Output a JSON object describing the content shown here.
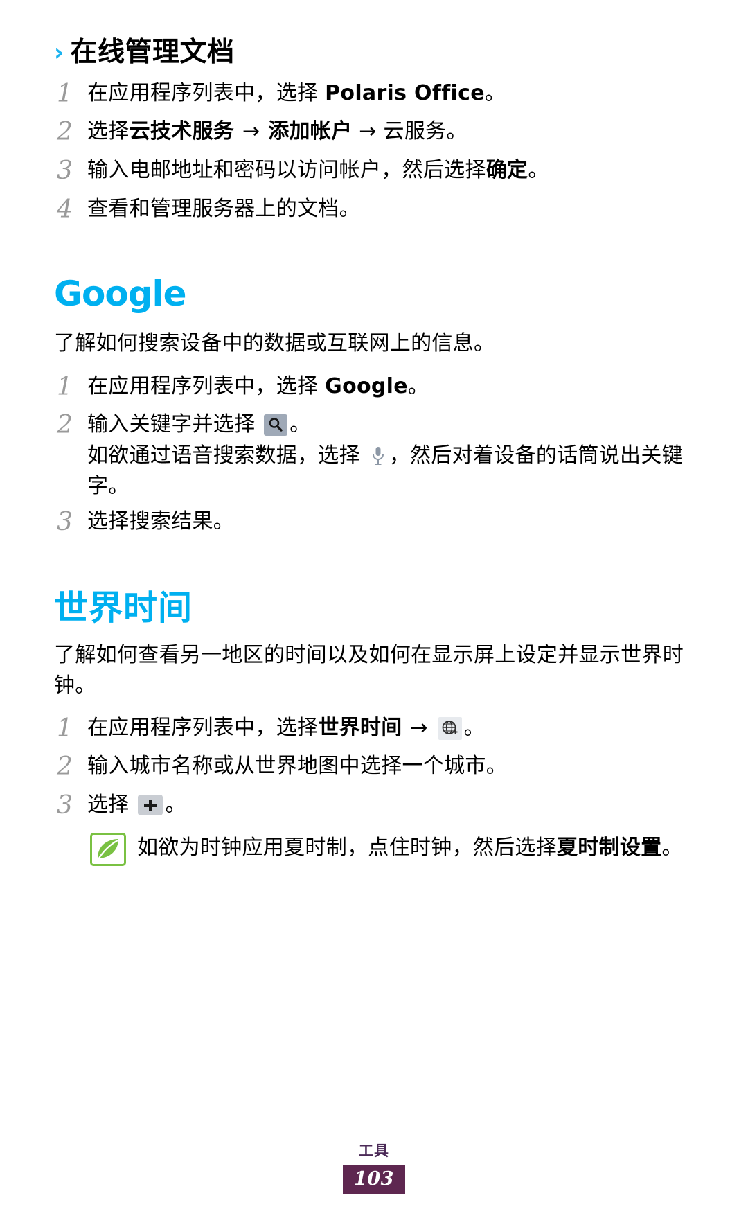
{
  "page": {
    "number": "103",
    "section_label": "工具"
  },
  "subsection": {
    "chevron": "›",
    "title": "在线管理文档",
    "steps": [
      {
        "num": "1",
        "parts": [
          {
            "t": "在应用程序列表中，选择 ",
            "b": false
          },
          {
            "t": "Polaris Office",
            "b": true
          },
          {
            "t": "。",
            "b": false
          }
        ]
      },
      {
        "num": "2",
        "parts": [
          {
            "t": "选择",
            "b": false
          },
          {
            "t": "云技术服务",
            "b": true
          },
          {
            "t": " → ",
            "b": false
          },
          {
            "t": "添加帐户",
            "b": true
          },
          {
            "t": " → 云服务。",
            "b": false
          }
        ]
      },
      {
        "num": "3",
        "parts": [
          {
            "t": "输入电邮地址和密码以访问帐户，然后选择",
            "b": false
          },
          {
            "t": "确定",
            "b": true
          },
          {
            "t": "。",
            "b": false
          }
        ]
      },
      {
        "num": "4",
        "parts": [
          {
            "t": "查看和管理服务器上的文档。",
            "b": false
          }
        ]
      }
    ]
  },
  "google": {
    "heading": "Google",
    "intro": "了解如何搜索设备中的数据或互联网上的信息。",
    "step1_num": "1",
    "step1_pre": "在应用程序列表中，选择 ",
    "step1_bold": "Google",
    "step1_post": "。",
    "step2_num": "2",
    "step2_pre": "输入关键字并选择 ",
    "step2_icon": "search-icon",
    "step2_post": "。",
    "step2_sub_pre": "如欲通过语音搜索数据，选择 ",
    "step2_sub_icon": "microphone-icon",
    "step2_sub_post": "，然后对着设备的话筒说出关键字。",
    "step3_num": "3",
    "step3_text": "选择搜索结果。"
  },
  "worldtime": {
    "heading": "世界时间",
    "intro": "了解如何查看另一地区的时间以及如何在显示屏上设定并显示世界时钟。",
    "step1_num": "1",
    "step1_pre": "在应用程序列表中，选择",
    "step1_bold": "世界时间",
    "step1_arrow": " → ",
    "step1_icon": "globe-add-icon",
    "step1_post": "。",
    "step2_num": "2",
    "step2_text": "输入城市名称或从世界地图中选择一个城市。",
    "step3_num": "3",
    "step3_pre": "选择 ",
    "step3_icon": "plus-icon",
    "step3_post": "。",
    "note_pre": "如欲为时钟应用夏时制，点住时钟，然后选择",
    "note_bold": "夏时制设置",
    "note_post": "。",
    "note_icon": "note-leaf-icon"
  },
  "colors": {
    "heading_cyan": "#00B0F0",
    "chevron_blue": "#1BB3F0",
    "step_number_gray": "#9A9A9A",
    "note_green": "#7AC143",
    "footer_purple": "#5E2750",
    "icon_search_bg": "#9FA9B7",
    "icon_globe_bg": "#E7EAEE",
    "icon_plus_bg": "#C9CDD3"
  }
}
